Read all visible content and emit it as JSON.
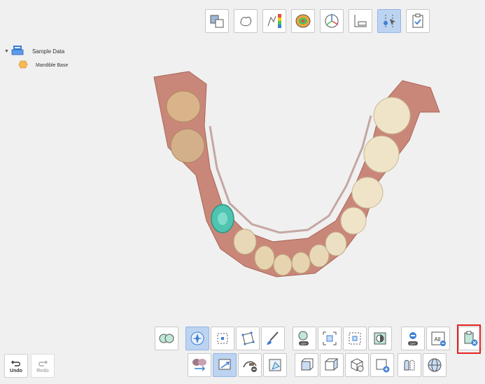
{
  "tree": {
    "root_label": "Sample Data",
    "child_label": "Mandible Base"
  },
  "top_toolbar": {
    "icons": [
      "align-icon",
      "crown-outline-icon",
      "deviation-map-icon",
      "occlusion-map-icon",
      "axis-icon",
      "measure-icon",
      "select-tool-icon",
      "checklist-icon"
    ],
    "active_index": 6
  },
  "bottom_toolbar": {
    "row1": [
      "dual-arch-icon",
      "smart-select-icon",
      "box-select-icon",
      "polygon-select-icon",
      "brush-select-icon",
      "select-off-icon",
      "fit-select-icon",
      "invert-select-icon",
      "half-fill-icon",
      "deselect-off-icon",
      "deselect-all-icon",
      "clear-selection-icon"
    ],
    "row2": [
      "swap-models-icon",
      "apply-selection-icon",
      "cut-sweep-icon",
      "mesh-clean-icon",
      "view-front-icon",
      "view-side-icon",
      "view-3d-icon",
      "add-view-icon",
      "mirror-icon",
      "globe-icon"
    ],
    "active_row1_index": 1,
    "active_row2_index": 1
  },
  "undo": {
    "label": "Undo"
  },
  "redo": {
    "label": "Redo"
  },
  "colors": {
    "gingiva": "#c9877a",
    "tooth": "#efe4c8",
    "prep": "#4fc4b0",
    "active_button": "#bcd3f1",
    "highlight": "#e52020"
  }
}
